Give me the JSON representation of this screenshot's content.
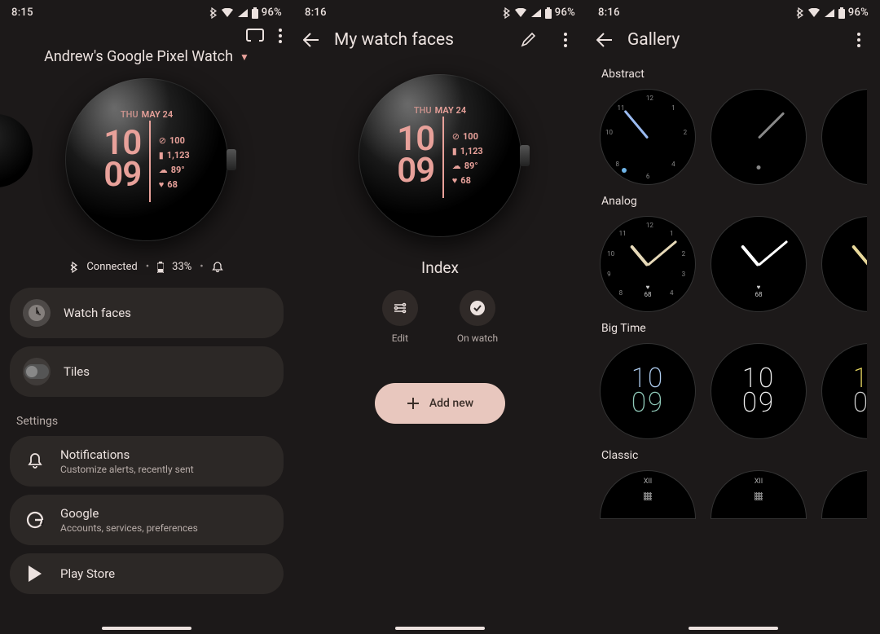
{
  "status": {
    "time_a": "8:15",
    "time_b": "8:16",
    "time_c": "8:16",
    "battery": "96%"
  },
  "pane1": {
    "device": "Andrew's Google Pixel Watch",
    "watchface": {
      "day": "THU",
      "date": "MAY 24",
      "hh": "10",
      "mm": "09",
      "c1": "100",
      "c2": "1,123",
      "c3": "89°",
      "c4": "68"
    },
    "status": {
      "label": "Connected",
      "pct": "33%"
    },
    "items": {
      "watch_faces": "Watch faces",
      "tiles": "Tiles"
    },
    "settings_header": "Settings",
    "settings": [
      {
        "title": "Notifications",
        "sub": "Customize alerts, recently sent"
      },
      {
        "title": "Google",
        "sub": "Accounts, services, preferences"
      },
      {
        "title": "Play Store",
        "sub": ""
      }
    ]
  },
  "pane2": {
    "title": "My watch faces",
    "watchface": {
      "day": "THU",
      "date": "MAY 24",
      "hh": "10",
      "mm": "09",
      "c1": "100",
      "c2": "1,123",
      "c3": "89°",
      "c4": "68"
    },
    "face_name": "Index",
    "actions": {
      "edit": "Edit",
      "on_watch": "On watch"
    },
    "add_new": "Add new"
  },
  "pane3": {
    "title": "Gallery",
    "sections": [
      "Abstract",
      "Analog",
      "Big Time",
      "Classic"
    ],
    "analog_hr": "68",
    "bigtime": {
      "hh": "10",
      "mm": "09"
    }
  }
}
